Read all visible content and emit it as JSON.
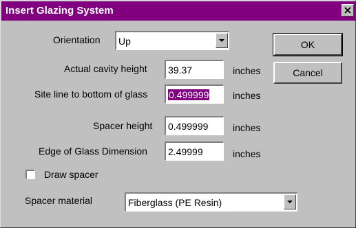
{
  "window": {
    "title": "Insert Glazing System",
    "close_label": "×"
  },
  "orientation": {
    "label": "Orientation",
    "value": "Up"
  },
  "cavity_height": {
    "label": "Actual cavity height",
    "value": "39.37",
    "unit": "inches"
  },
  "site_line": {
    "label": "Site line to bottom of glass",
    "value": "0.499999",
    "unit": "inches"
  },
  "spacer_height": {
    "label": "Spacer height",
    "value": "0.499999",
    "unit": "inches"
  },
  "edge_of_glass": {
    "label": "Edge of Glass Dimension",
    "value": "2.49999",
    "unit": "inches"
  },
  "draw_spacer": {
    "label": "Draw spacer",
    "checked": false
  },
  "spacer_material": {
    "label": "Spacer material",
    "value": "Fiberglass (PE Resin)"
  },
  "buttons": {
    "ok": "OK",
    "cancel": "Cancel"
  },
  "colors": {
    "titlebar": "#800080",
    "selection": "#800080",
    "face": "#c0c0c0"
  }
}
